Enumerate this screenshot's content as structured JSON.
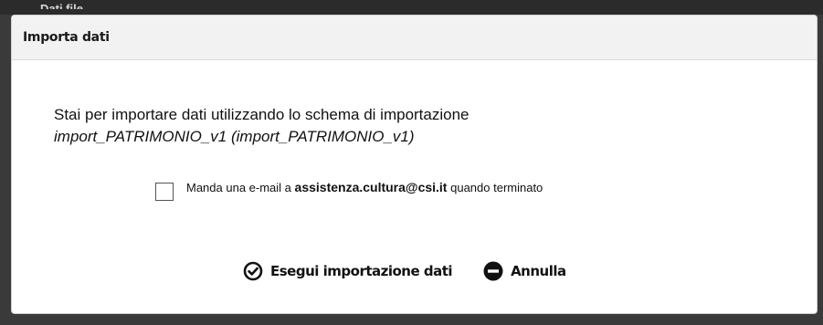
{
  "backdrop": {
    "peek_text": "Dati file"
  },
  "dialog": {
    "title": "Importa dati",
    "message": "Stai per importare dati utilizzando lo schema di importazione",
    "schema_name": "import_PATRIMONIO_v1 (import_PATRIMONIO_v1)",
    "email_option": {
      "checked": false,
      "prefix": "Manda una e-mail a",
      "address": "assistenza.cultura@csi.it",
      "suffix": "quando terminato"
    },
    "buttons": {
      "run_label": "Esegui importazione dati",
      "run_icon": "check-circle-icon",
      "cancel_label": "Annulla",
      "cancel_icon": "minus-circle-icon"
    }
  },
  "colors": {
    "titlebar_bg": "#f2f2f2",
    "backdrop": "#3a3a3a",
    "text": "#111111"
  }
}
